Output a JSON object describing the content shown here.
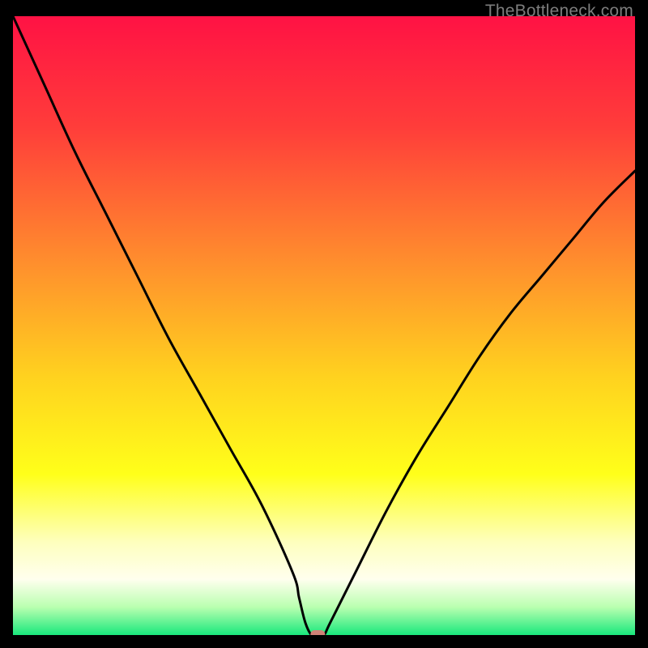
{
  "watermark": "TheBottleneck.com",
  "chart_data": {
    "type": "line",
    "title": "",
    "xlabel": "",
    "ylabel": "",
    "xlim": [
      0,
      100
    ],
    "ylim": [
      0,
      100
    ],
    "series": [
      {
        "name": "bottleneck-curve",
        "x": [
          0,
          5,
          10,
          15,
          20,
          25,
          30,
          35,
          40,
          45,
          46,
          47,
          48,
          49,
          50,
          51,
          55,
          60,
          65,
          70,
          75,
          80,
          85,
          90,
          95,
          100
        ],
        "y": [
          100,
          89,
          78,
          68,
          58,
          48,
          39,
          30,
          21,
          10,
          6,
          2,
          0,
          0,
          0,
          2,
          10,
          20,
          29,
          37,
          45,
          52,
          58,
          64,
          70,
          75
        ]
      }
    ],
    "marker": {
      "x": 49,
      "y": 0,
      "color": "#d08277"
    },
    "gradient_stops": [
      {
        "offset": 0.0,
        "color": "#ff1244"
      },
      {
        "offset": 0.18,
        "color": "#ff3d3a"
      },
      {
        "offset": 0.4,
        "color": "#ff8f2d"
      },
      {
        "offset": 0.58,
        "color": "#ffd11f"
      },
      {
        "offset": 0.74,
        "color": "#ffff1a"
      },
      {
        "offset": 0.85,
        "color": "#feffbe"
      },
      {
        "offset": 0.91,
        "color": "#ffffee"
      },
      {
        "offset": 0.955,
        "color": "#b9ffb0"
      },
      {
        "offset": 1.0,
        "color": "#19e87c"
      }
    ]
  }
}
